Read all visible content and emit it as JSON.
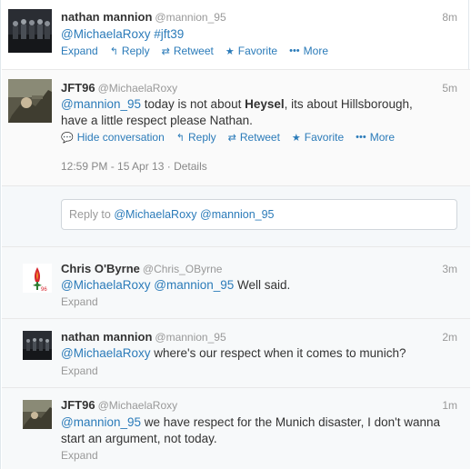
{
  "tweets": [
    {
      "name": "nathan mannion",
      "handle": "@mannion_95",
      "time": "8m",
      "mention": "@MichaelaRoxy",
      "hashtag": "#jft39",
      "expand": "Expand",
      "reply": "Reply",
      "retweet": "Retweet",
      "favorite": "Favorite",
      "more": "More"
    },
    {
      "name": "JFT96",
      "handle": "@MichaelaRoxy",
      "time": "5m",
      "mention": "@mannion_95",
      "text_a": " today is not about ",
      "bold": "Heysel",
      "text_b": ", its about Hillsborough,",
      "text_line2": "have a little respect please Nathan.",
      "hide": "Hide conversation",
      "reply": "Reply",
      "retweet": "Retweet",
      "favorite": "Favorite",
      "more": "More",
      "timestamp": "12:59 PM - 15 Apr 13",
      "details": "Details"
    },
    {
      "name": "Chris O'Byrne",
      "handle": "@Chris_OByrne",
      "time": "3m",
      "mention1": "@MichaelaRoxy",
      "mention2": "@mannion_95",
      "text": " Well said.",
      "expand": "Expand"
    },
    {
      "name": "nathan mannion",
      "handle": "@mannion_95",
      "time": "2m",
      "mention": "@MichaelaRoxy",
      "text": " where's our respect when it comes to munich?",
      "expand": "Expand"
    },
    {
      "name": "JFT96",
      "handle": "@MichaelaRoxy",
      "time": "1m",
      "mention": "@mannion_95",
      "text_a": " we have respect for the Munich disaster, I don't wanna",
      "text_line2": "start an argument, not today.",
      "expand": "Expand"
    }
  ],
  "reply_box": {
    "prefix": "Reply to ",
    "mentions": "@MichaelaRoxy @mannion_95"
  },
  "colors": {
    "link": "#2b7bb9",
    "muted": "#999999"
  }
}
